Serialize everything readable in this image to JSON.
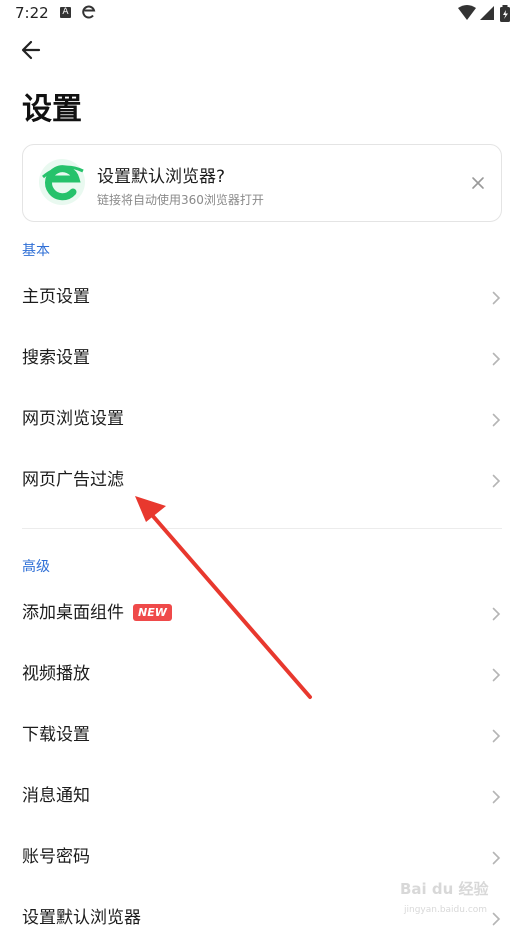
{
  "status_bar": {
    "time": "7:22",
    "icon_a_text": "A",
    "icons": [
      "notification-a-icon",
      "browser-e-icon",
      "wifi-icon",
      "signal-icon",
      "battery-icon"
    ]
  },
  "header": {
    "title": "设置"
  },
  "promo_card": {
    "title": "设置默认浏览器?",
    "subtitle": "链接将自动使用360浏览器打开",
    "logo_color": "#26c26b"
  },
  "sections": [
    {
      "label": "基本",
      "items": [
        {
          "label": "主页设置"
        },
        {
          "label": "搜索设置"
        },
        {
          "label": "网页浏览设置"
        },
        {
          "label": "网页广告过滤"
        }
      ]
    },
    {
      "label": "高级",
      "items": [
        {
          "label": "添加桌面组件",
          "badge": "NEW"
        },
        {
          "label": "视频播放"
        },
        {
          "label": "下载设置"
        },
        {
          "label": "消息通知"
        },
        {
          "label": "账号密码"
        },
        {
          "label": "设置默认浏览器"
        }
      ]
    }
  ],
  "watermark": {
    "logo": "Bai du 经验",
    "url": "jingyan.baidu.com"
  },
  "colors": {
    "section_label": "#2f6fd6",
    "badge": "#ef4a4a",
    "annotation_arrow": "#e8382e"
  }
}
